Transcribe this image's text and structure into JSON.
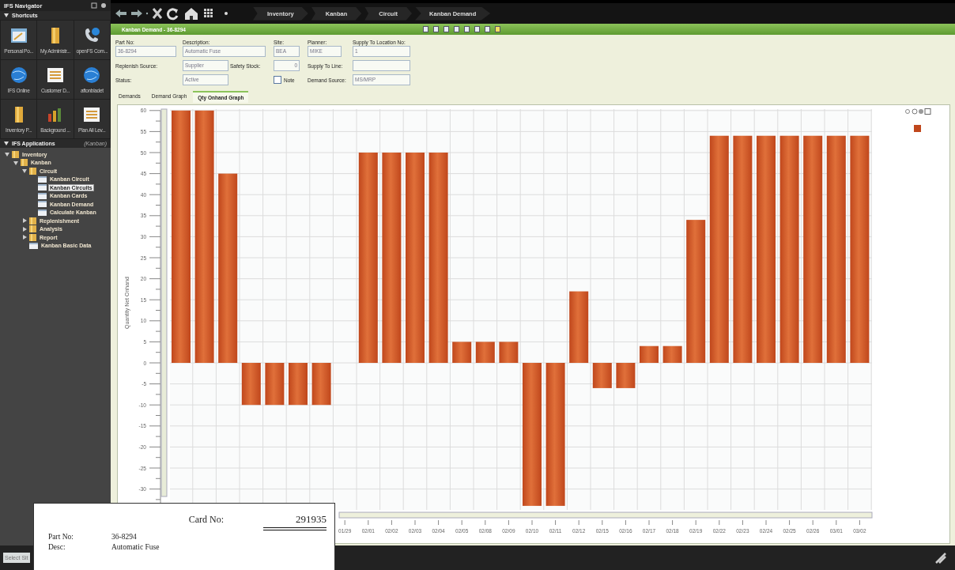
{
  "navigator": {
    "title": "IFS Navigator",
    "shortcuts_header": "Shortcuts",
    "shortcuts": [
      {
        "label": "Personal Po...",
        "kind": "portal"
      },
      {
        "label": "My Administr...",
        "kind": "folder"
      },
      {
        "label": "openFS Com...",
        "kind": "phone"
      },
      {
        "label": "IFS Online",
        "kind": "globe"
      },
      {
        "label": "Customer D...",
        "kind": "list"
      },
      {
        "label": "aftonbladet",
        "kind": "globe"
      },
      {
        "label": "Inventory P...",
        "kind": "folder"
      },
      {
        "label": "Background ...",
        "kind": "chart"
      },
      {
        "label": "Plan All Lev...",
        "kind": "list"
      }
    ]
  },
  "applications": {
    "title": "IFS Applications",
    "filter": "(Kanban)",
    "tree": [
      {
        "label": "Inventory",
        "kind": "folder",
        "expanded": true,
        "selected": false,
        "children": [
          {
            "label": "Kanban",
            "kind": "folder",
            "expanded": true,
            "selected": false,
            "children": [
              {
                "label": "Circuit",
                "kind": "folder",
                "expanded": true,
                "selected": false,
                "children": [
                  {
                    "label": "Kanban Circuit",
                    "kind": "page",
                    "selected": false
                  },
                  {
                    "label": "Kanban Circuits",
                    "kind": "page",
                    "selected": true
                  },
                  {
                    "label": "Kanban Cards",
                    "kind": "page",
                    "selected": false
                  },
                  {
                    "label": "Kanban Demand",
                    "kind": "page",
                    "selected": false
                  },
                  {
                    "label": "Calculate Kanban",
                    "kind": "page",
                    "selected": false
                  }
                ]
              },
              {
                "label": "Replenishment",
                "kind": "folder",
                "expanded": false,
                "selected": false
              },
              {
                "label": "Analysis",
                "kind": "folder",
                "expanded": false,
                "selected": false
              },
              {
                "label": "Report",
                "kind": "folder",
                "expanded": false,
                "selected": false
              },
              {
                "label": "Kanban Basic Data",
                "kind": "page",
                "selected": false
              }
            ]
          }
        ]
      }
    ]
  },
  "breadcrumbs": [
    "Inventory",
    "Kanban",
    "Circuit",
    "Kanban Demand"
  ],
  "window": {
    "title": "Kanban Demand - 36-8294"
  },
  "form": {
    "part_no": {
      "label": "Part No:",
      "value": "36-8294"
    },
    "description": {
      "label": "Description:",
      "value": "Automatic Fuse"
    },
    "site": {
      "label": "Site:",
      "value": "BEA"
    },
    "planner": {
      "label": "Planner:",
      "value": "MIKE"
    },
    "supply_to_location_no": {
      "label": "Supply To Location No:",
      "value": "1"
    },
    "replenish_source": {
      "label": "Replenish Source:",
      "value": "Supplier"
    },
    "safety_stock": {
      "label": "Safety Stock:",
      "value": "0"
    },
    "supply_to_line": {
      "label": "Supply To Line:"
    },
    "status": {
      "label": "Status:",
      "value": "Active"
    },
    "note": {
      "label": "Note",
      "checked": false
    },
    "demand_source": {
      "label": "Demand Source:",
      "value": "MS/MRP"
    }
  },
  "tabs": [
    {
      "label": "Demands",
      "selected": false
    },
    {
      "label": "Demand Graph",
      "selected": false
    },
    {
      "label": "Qty Onhand Graph",
      "selected": true
    }
  ],
  "chart_data": {
    "type": "bar",
    "ylabel": "Quantity Net Onhand",
    "grid": true,
    "categories": [
      null,
      null,
      null,
      null,
      null,
      null,
      null,
      "01/29",
      "02/01",
      "02/02",
      "02/03",
      "02/04",
      "02/05",
      "02/08",
      "02/09",
      "02/10",
      "02/11",
      "02/12",
      "02/15",
      "02/16",
      "02/17",
      "02/18",
      "02/19",
      "02/22",
      "02/23",
      "02/24",
      "02/25",
      "02/26",
      "03/01",
      "03/02"
    ],
    "series": [
      {
        "color": "#c0471c",
        "values": [
          60,
          60,
          45,
          -10,
          -10,
          -10,
          -10,
          null,
          50,
          50,
          50,
          50,
          5,
          5,
          5,
          -34,
          -34,
          17,
          -6,
          -6,
          4,
          4,
          34,
          54,
          54,
          54,
          54,
          54,
          54,
          54
        ]
      }
    ],
    "ylim": [
      -35,
      60
    ],
    "yticks": [
      -30,
      -25,
      -20,
      -15,
      -10,
      -5,
      0,
      5,
      10,
      15,
      20,
      25,
      30,
      35,
      40,
      45,
      50,
      55,
      60
    ]
  },
  "card": {
    "card_no_label": "Card No:",
    "card_no": "291935",
    "rows": [
      {
        "label": "Part No:",
        "value": "36-8294"
      },
      {
        "label": "Desc:",
        "value": "Automatic Fuse"
      }
    ]
  },
  "status_bar": {
    "site_field": {
      "placeholder": "Select Sit"
    }
  }
}
